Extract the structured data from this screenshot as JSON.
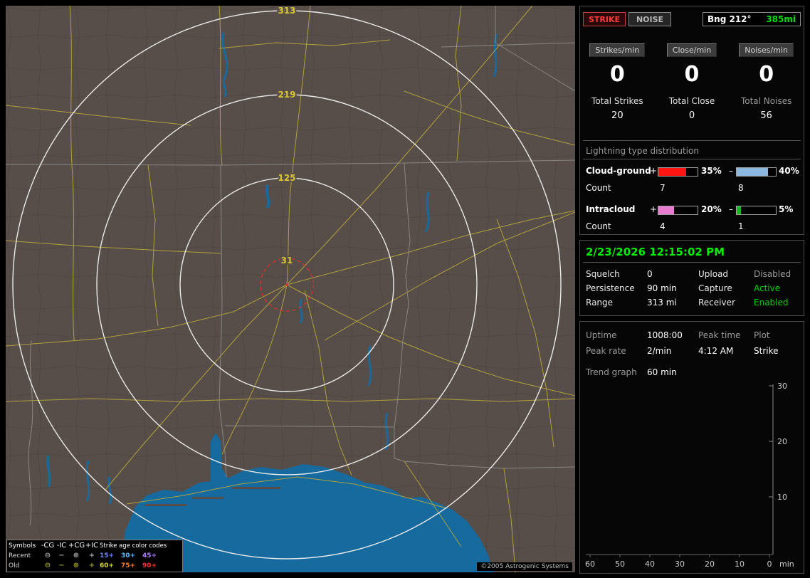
{
  "map": {
    "ring_labels": [
      "313",
      "219",
      "125",
      "31"
    ],
    "copyright": "©2005 Astrogenic Systems",
    "legend": {
      "symbols_title": "Symbols",
      "columns": [
        "-CG",
        "-IC",
        "+CG",
        "+IC"
      ],
      "age_title": "Strike age color codes",
      "recent": {
        "label": "Recent",
        "symbol_color": "#d8d8d8",
        "symbols": [
          "⊖",
          "−",
          "⊕",
          "+"
        ],
        "ages": [
          {
            "text": "15+",
            "color": "#6a8cff"
          },
          {
            "text": "30+",
            "color": "#58c0ff"
          },
          {
            "text": "45+",
            "color": "#b07cff"
          }
        ]
      },
      "old": {
        "label": "Old",
        "symbol_color": "#c8c832",
        "symbols": [
          "⊖",
          "−",
          "⊕",
          "+"
        ],
        "ages": [
          {
            "text": "60+",
            "color": "#d8d832"
          },
          {
            "text": "75+",
            "color": "#ff8020"
          },
          {
            "text": "90+",
            "color": "#ff3030"
          }
        ]
      }
    }
  },
  "panel": {
    "strike_button": "STRIKE",
    "noise_button": "NOISE",
    "bearing": "Bng 212°",
    "distance": "385mi",
    "distance_color": "#00e000",
    "rates": [
      {
        "label": "Strikes/min",
        "value": "0"
      },
      {
        "label": "Close/min",
        "value": "0"
      },
      {
        "label": "Noises/min",
        "value": "0"
      }
    ],
    "totals": [
      {
        "label": "Total Strikes",
        "value": "20"
      },
      {
        "label": "Total Close",
        "value": "0"
      },
      {
        "label": "Total Noises",
        "value": "56"
      }
    ],
    "distribution": {
      "title": "Lightning type distribution",
      "rows": [
        {
          "label": "Cloud-ground",
          "plus_sign": "+",
          "minus_sign": "–",
          "plus_pct": "35%",
          "minus_pct": "40%",
          "plus_fill": "70%",
          "minus_fill": "80%",
          "plus_color": "#ff1414",
          "minus_color": "#8cb8e0",
          "count_label": "Count",
          "plus_count": "7",
          "minus_count": "8"
        },
        {
          "label": "Intracloud",
          "plus_sign": "+",
          "minus_sign": "–",
          "plus_pct": "20%",
          "minus_pct": "5%",
          "plus_fill": "40%",
          "minus_fill": "10%",
          "plus_color": "#e87ad0",
          "minus_color": "#18b818",
          "count_label": "Count",
          "plus_count": "4",
          "minus_count": "1"
        }
      ]
    },
    "status": {
      "datetime": "2/23/2026 12:15:02 PM",
      "rows": [
        {
          "label1": "Squelch",
          "value1": "0",
          "label2": "Upload",
          "value2": "Disabled",
          "value2_color": "#9a9a9a"
        },
        {
          "label1": "Persistence",
          "value1": "90 min",
          "label2": "Capture",
          "value2": "Active",
          "value2_color": "#00d000"
        },
        {
          "label1": "Range",
          "value1": "313 mi",
          "label2": "Receiver",
          "value2": "Enabled",
          "value2_color": "#00d000"
        }
      ]
    },
    "session": {
      "uptime_label": "Uptime",
      "uptime_value": "1008:00",
      "peak_time_label": "Peak time",
      "plot_label": "Plot",
      "peak_rate_label": "Peak rate",
      "peak_rate_value": "2/min",
      "peak_time_value": "4:12 AM",
      "plot_value": "Strike",
      "trend_label": "Trend graph",
      "trend_value": "60 min"
    },
    "trend_graph": {
      "y_ticks": [
        "30",
        "20",
        "10"
      ],
      "x_ticks": [
        "60",
        "50",
        "40",
        "30",
        "20",
        "10",
        "0"
      ],
      "x_unit": "min"
    }
  }
}
